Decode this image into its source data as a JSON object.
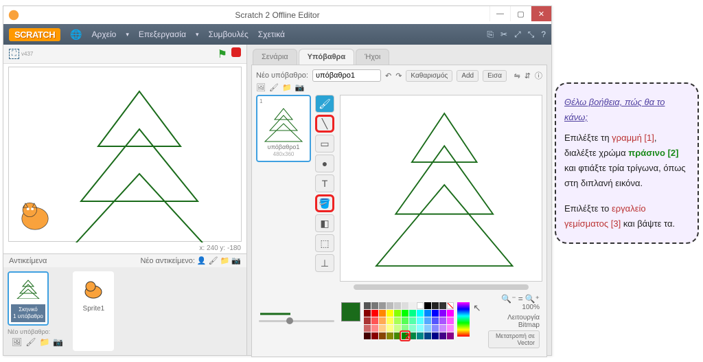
{
  "window": {
    "title": "Scratch 2 Offline Editor"
  },
  "menubar": {
    "logo": "SCRATCH",
    "items": [
      "Αρχείο",
      "Επεξεργασία",
      "Συμβουλές",
      "Σχετικά"
    ]
  },
  "stage": {
    "version": "v437",
    "coords": "x: 240   y: -180"
  },
  "sprites": {
    "header": "Αντικείμενα",
    "new_label": "Νέο αντικείμενο:",
    "stage_thumb": {
      "title": "Σκηνικό",
      "sub": "1 υπόβαθρο"
    },
    "sprite1": "Sprite1",
    "new_backdrop_label": "Νέο υπόβαθρο:"
  },
  "tabs": {
    "scripts": "Σενάρια",
    "backdrops": "Υπόβαθρα",
    "sounds": "Ήχοι"
  },
  "editor": {
    "new_backdrop": "Νέο υπόβαθρο:",
    "name": "υπόβαθρο1",
    "clear": "Καθαρισμός",
    "add": "Add",
    "import": "Εισα",
    "thumb": {
      "name": "υπόβαθρο1",
      "dim": "480x360",
      "num": "1"
    },
    "zoom": "100%",
    "mode": "Λειτουργία Bitmap",
    "convert": "Μετατροπή σε Vector"
  },
  "markers": {
    "m1": "1",
    "m2": "2",
    "m3": "3"
  },
  "help": {
    "title": "Θέλω βοήθεια, πώς θα το κάνω;",
    "p1a": "Επιλέξτε τη ",
    "p1b": "γραμμή [1]",
    "p1c": ", διαλέξτε χρώμα ",
    "p1d": "πράσινο [2]",
    "p1e": " και φτιάξτε τρία τρίγωνα, όπως στη διπλανή εικόνα.",
    "p2a": "Επιλέξτε το ",
    "p2b": "εργαλείο γεμίσματος [3]",
    "p2c": " και βάψτε τα."
  }
}
